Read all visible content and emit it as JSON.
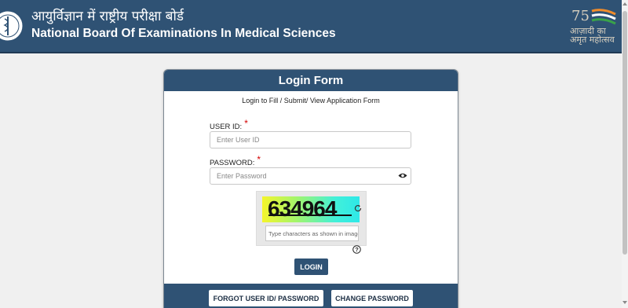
{
  "header": {
    "hindi_title": "आयुर्विज्ञान में राष्ट्रीय परीक्षा बोर्ड",
    "english_title": "National Board Of Examinations In Medical Sciences",
    "azadi_hindi_top": "आज़ादी का",
    "azadi_hindi_bottom": "अमृत महोत्सव"
  },
  "form": {
    "title": "Login Form",
    "subtitle": "Login to Fill / Submit/ View Application Form",
    "user_id_label": "USER ID:",
    "user_id_placeholder": "Enter User ID",
    "password_label": "PASSWORD:",
    "password_placeholder": "Enter Password",
    "required_mark": "*",
    "captcha_text": "634964",
    "captcha_placeholder": "Type characters as shown in image",
    "login_label": "LOGIN",
    "forgot_label": "FORGOT USER ID/ PASSWORD",
    "change_label": "CHANGE PASSWORD"
  },
  "icons": {
    "logo": "nbe-logo-icon",
    "azadi": "azadi-ka-amrit-mahotsav-logo-icon",
    "eye": "eye-icon",
    "refresh": "refresh-icon",
    "help": "question-icon"
  },
  "colors": {
    "primary": "#2f5274",
    "required": "#d40000",
    "page_bg": "#f0f0f0"
  }
}
